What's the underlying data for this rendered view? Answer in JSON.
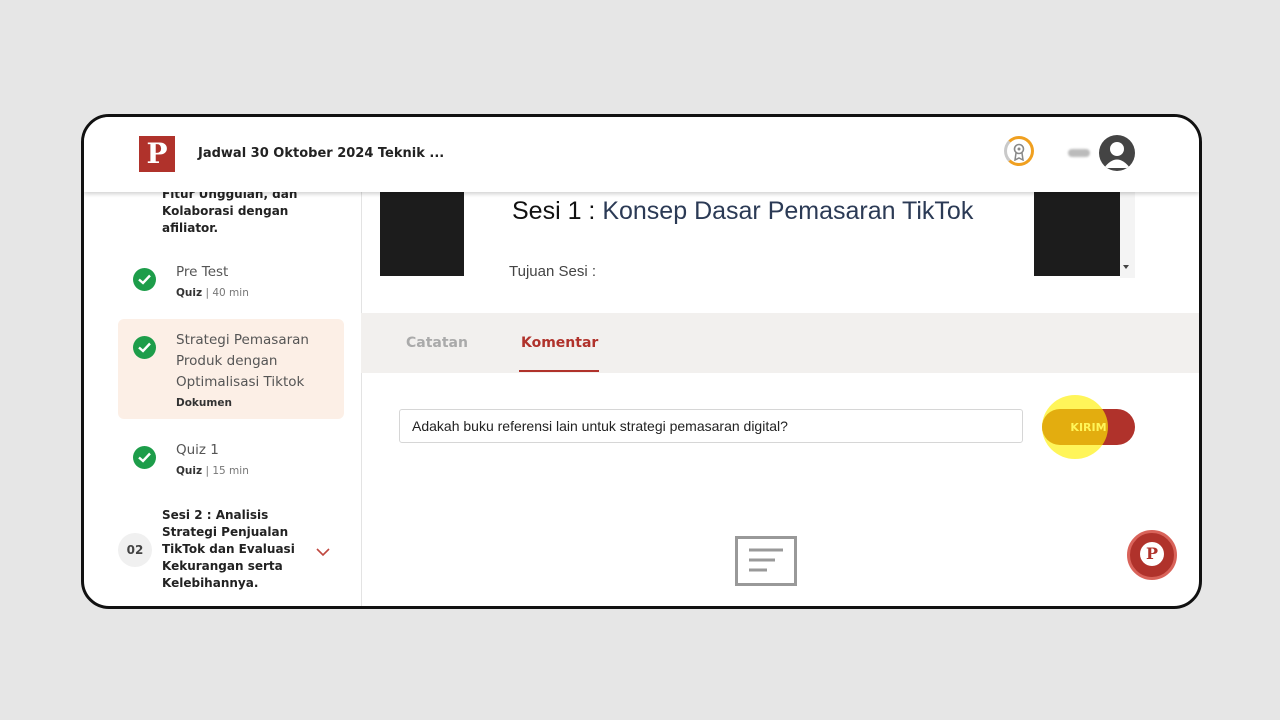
{
  "header": {
    "logo_letter": "P",
    "title": "Jadwal 30 Oktober 2024 Teknik ...",
    "icons": [
      "badge-icon",
      "avatar-icon"
    ]
  },
  "sidebar": {
    "truncated_section_title": "Fitur Unggulan, dan Kolaborasi dengan afiliator.",
    "items": [
      {
        "title": "Pre Test",
        "type": "Quiz",
        "duration": "| 40 min",
        "completed": true,
        "active": false
      },
      {
        "title": "Strategi Pemasaran Produk dengan Optimalisasi Tiktok",
        "type": "Dokumen",
        "duration": "",
        "completed": true,
        "active": true
      },
      {
        "title": "Quiz 1",
        "type": "Quiz",
        "duration": "| 15 min",
        "completed": true,
        "active": false
      }
    ],
    "next_section": {
      "number": "02",
      "title": "Sesi 2 : Analisis Strategi Penjualan TikTok dan Evaluasi Kekurangan serta Kelebihannya."
    }
  },
  "content": {
    "session_prefix": "Sesi 1 : ",
    "session_title": "Konsep Dasar Pemasaran TikTok",
    "objective_label": "Tujuan Sesi :"
  },
  "tabs": [
    {
      "label": "Catatan",
      "active": false
    },
    {
      "label": "Komentar",
      "active": true
    }
  ],
  "comment": {
    "value": "Adakah buku referensi lain untuk strategi pemasaran digital?",
    "send_label": "KIRIM"
  },
  "fab_letter": "P",
  "colors": {
    "brand": "#b0322b",
    "success": "#1d9d4a",
    "active_bg": "#fcefe6"
  }
}
